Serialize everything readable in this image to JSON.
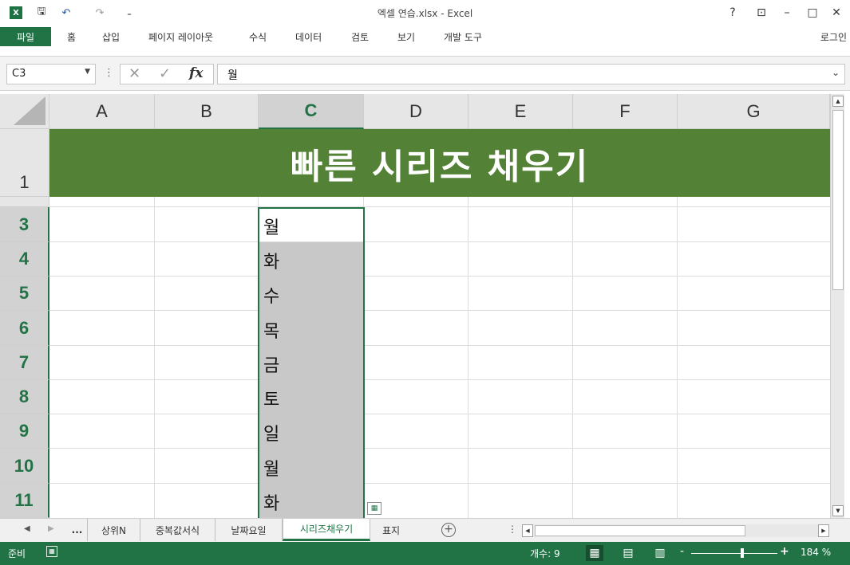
{
  "window": {
    "title": "엑셀 연습.xlsx - Excel",
    "logo_label": "X",
    "quick_access": {
      "save": "🖫",
      "undo": "↶",
      "redo": "↷",
      "more": "₌"
    },
    "controls": {
      "help": "?",
      "ribbon_display": "⊡",
      "minimize": "–",
      "maximize": "□",
      "close": "✕"
    }
  },
  "ribbon": {
    "file_tab": "파일",
    "tabs": [
      "홈",
      "삽입",
      "페이지 레이아웃",
      "수식",
      "데이터",
      "검토",
      "보기",
      "개발 도구"
    ],
    "login": "로그인"
  },
  "formula_bar": {
    "name_box": "C3",
    "cancel_icon": "✕",
    "enter_icon": "✓",
    "fx_label": "fx",
    "formula": "월"
  },
  "grid": {
    "columns": [
      "A",
      "B",
      "C",
      "D",
      "E",
      "F",
      "G"
    ],
    "selected_column": "C",
    "rows": [
      "1",
      "3",
      "4",
      "5",
      "6",
      "7",
      "8",
      "9",
      "10",
      "11"
    ],
    "banner_text": "빠른 시리즈 채우기",
    "column_c_values": [
      "월",
      "화",
      "수",
      "목",
      "금",
      "토",
      "일",
      "월",
      "화"
    ],
    "active_cell": "C3"
  },
  "sheet_tabs": {
    "overflow": "...",
    "tabs": [
      "상위N",
      "중복값서식",
      "날짜요일",
      "시리즈채우기",
      "표지"
    ],
    "active": "시리즈채우기",
    "add_icon": "+"
  },
  "status_bar": {
    "ready": "준비",
    "count": "개수: 9",
    "zoom_minus": "-",
    "zoom_plus": "+",
    "zoom": "184 %",
    "accent_color": "#217346",
    "banner_color": "#538135",
    "zoom_fraction": 0.59
  }
}
